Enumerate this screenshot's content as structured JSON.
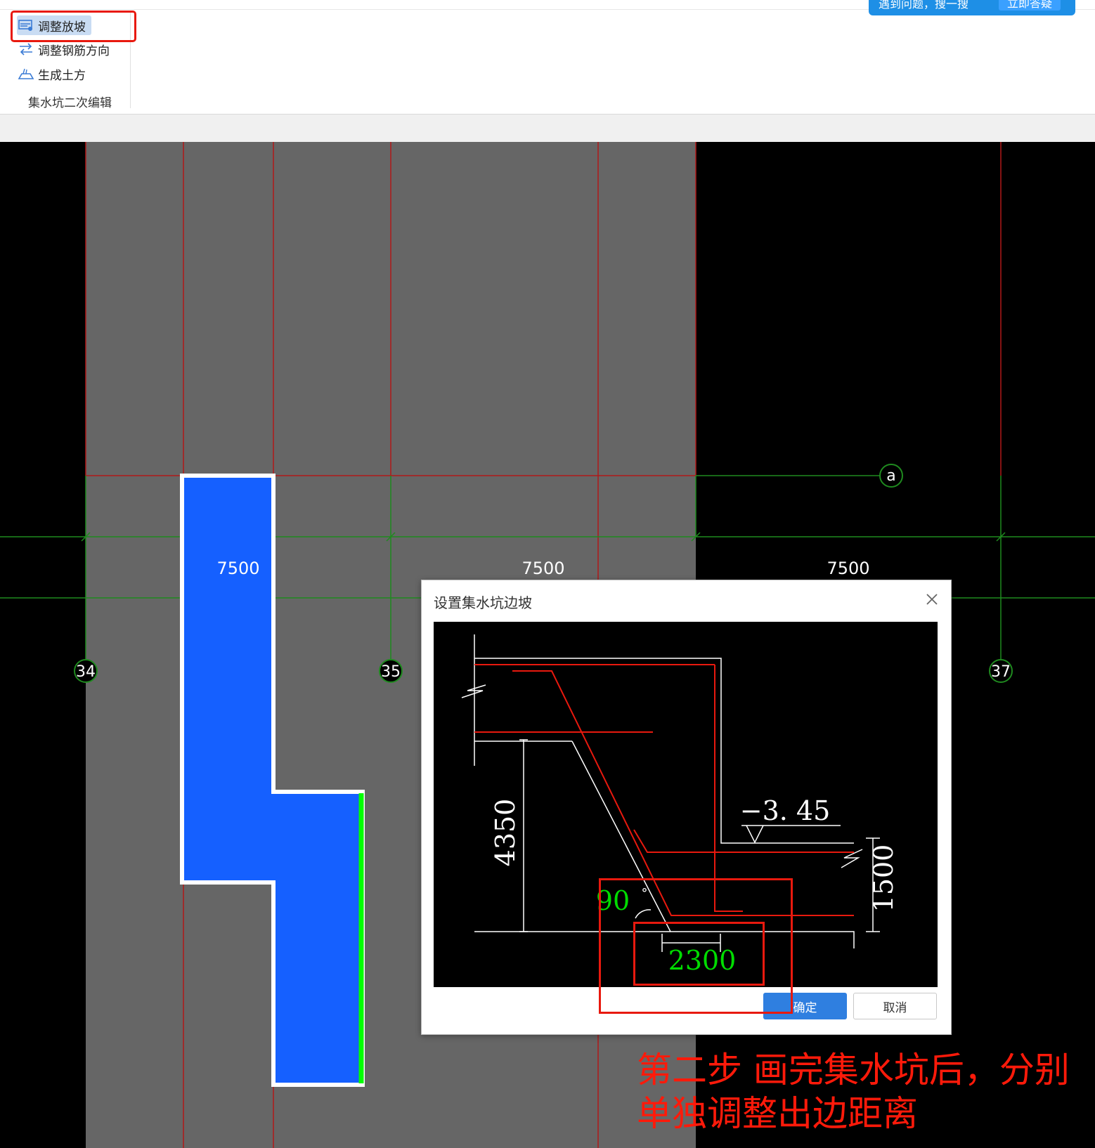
{
  "ribbon": {
    "items": [
      {
        "label": "调整放坡",
        "icon": "adjust-slope-icon"
      },
      {
        "label": "调整钢筋方向",
        "icon": "rebar-direction-icon"
      },
      {
        "label": "生成土方",
        "icon": "earthwork-icon"
      }
    ],
    "group_label": "集水坑二次编辑",
    "help_text": "遇到问题，搜一搜",
    "help_button": "立即答疑"
  },
  "canvas": {
    "spans": [
      "7500",
      "7500",
      "7500"
    ],
    "axes": [
      "34",
      "35",
      "37"
    ],
    "row_axis": "a"
  },
  "dialog": {
    "title": "设置集水坑边坡",
    "ok_label": "确定",
    "cancel_label": "取消",
    "preview": {
      "elevation": "−3. 45",
      "depth": "4350",
      "thickness": "1500",
      "angle": "90",
      "degree_mark": "°",
      "offset": "2300"
    }
  },
  "annotation": {
    "text": "第二步 画完集水坑后，分别单独调整出边距离"
  },
  "colors": {
    "canvas_bg": "#000000",
    "slab_gray": "#666666",
    "pit_blue": "#1560ff",
    "grid_red": "#b01818",
    "axis_green": "#1f8a1f",
    "edge_green": "#00ff00",
    "highlight_red": "#e8190e"
  }
}
